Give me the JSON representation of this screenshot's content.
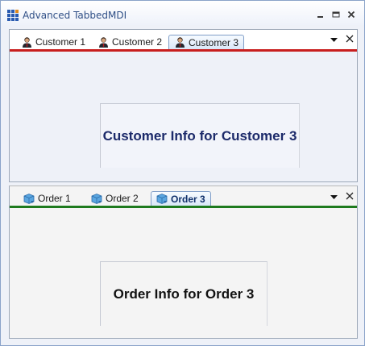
{
  "window": {
    "title": "Advanced TabbedMDI",
    "icon": "app-grid-icon",
    "controls": [
      "minimize-icon",
      "maximize-icon",
      "close-icon"
    ]
  },
  "top_pane": {
    "accent_color": "#c81e1e",
    "tabs": [
      {
        "label": "Customer 1",
        "icon": "customer-icon",
        "active": false
      },
      {
        "label": "Customer 2",
        "icon": "customer-icon",
        "active": false
      },
      {
        "label": "Customer 3",
        "icon": "customer-icon",
        "active": true
      }
    ],
    "content_text": "Customer Info for Customer 3"
  },
  "bottom_pane": {
    "accent_color": "#1e7a1e",
    "tabs": [
      {
        "label": "Order 1",
        "icon": "order-icon",
        "active": false
      },
      {
        "label": "Order 2",
        "icon": "order-icon",
        "active": false
      },
      {
        "label": "Order 3",
        "icon": "order-icon",
        "active": true
      }
    ],
    "content_text": "Order Info for Order 3"
  }
}
